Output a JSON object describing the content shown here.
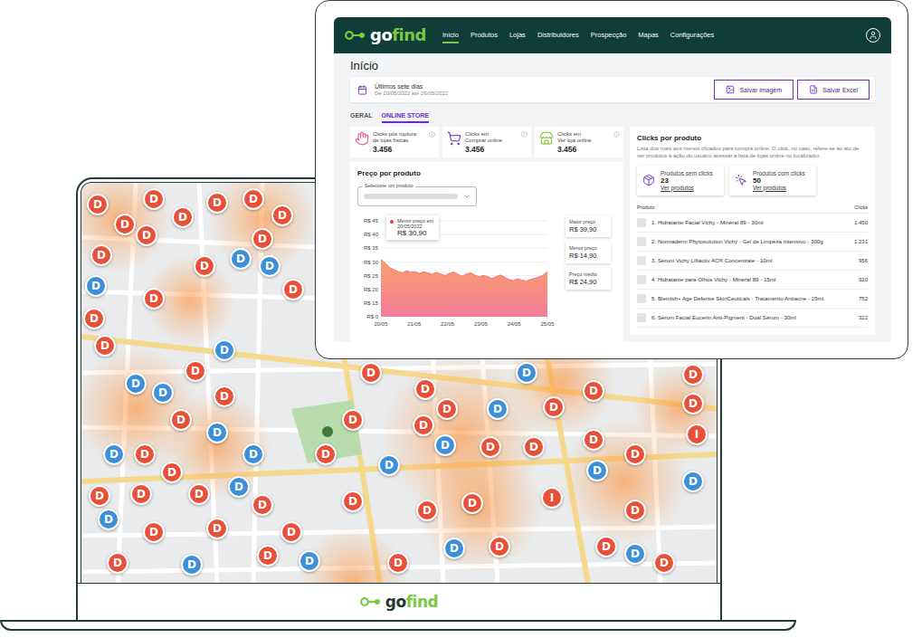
{
  "dashboard": {
    "logo": {
      "prefix": "go",
      "suffix": "find"
    },
    "nav": [
      {
        "label": "Início",
        "selected": true
      },
      {
        "label": "Produtos",
        "selected": false
      },
      {
        "label": "Lojas",
        "selected": false
      },
      {
        "label": "Distribuidores",
        "selected": false
      },
      {
        "label": "Prospecção",
        "selected": false
      },
      {
        "label": "Mapas",
        "selected": false
      },
      {
        "label": "Configurações",
        "selected": false
      }
    ],
    "page_title": "Início",
    "date_range": {
      "title": "Últimos sete dias",
      "subtitle": "De 20/05/2022 até 26/05/2022"
    },
    "actions": [
      "Salvar imagem",
      "Salvar Excel"
    ],
    "tabs": [
      {
        "label": "GERAL",
        "selected": false
      },
      {
        "label": "ONLINE STORE",
        "selected": true
      }
    ],
    "stats": [
      {
        "label_lines": [
          "Clicks pós ruptura",
          "de lojas físicas"
        ],
        "value": "3.456",
        "color": "#e8507a"
      },
      {
        "label_lines": [
          "Clicks em",
          "Comprar online"
        ],
        "value": "3.456",
        "color": "#6a2cc4"
      },
      {
        "label_lines": [
          "Clicks em",
          "Ver loja online"
        ],
        "value": "3.456",
        "color": "#7bbf2a"
      }
    ],
    "price_chart": {
      "title": "Preço por produto",
      "select_label": "Selecione um produto",
      "y_ticks": [
        "R$ 45",
        "R$ 40",
        "R$ 35",
        "R$ 30",
        "R$ 25",
        "R$ 20",
        "R$ 15",
        "R$ 0"
      ],
      "x_ticks": [
        "20/05",
        "21/05",
        "22/05",
        "23/05",
        "24/05",
        "25/05"
      ],
      "values": [
        30.9,
        29.5,
        28,
        27.2,
        26.5,
        26,
        26.8,
        26.2,
        26.5,
        25.8,
        26.4,
        26,
        25.5,
        26.2,
        25.6,
        25,
        25.8,
        26.3,
        25.5,
        24.8,
        25.6,
        26,
        25.2,
        24.5,
        25.1,
        24.6,
        24,
        24.6,
        25.2,
        24.4,
        23.6,
        23.2,
        23.8,
        23.4,
        23,
        23.6,
        24,
        24.5,
        25.2,
        26.5
      ],
      "tooltip": {
        "title": "Menor preço em",
        "date": "20/05/2022",
        "value": "R$ 30,90"
      },
      "summary": [
        {
          "label": "Maior preço",
          "value": "R$ 39,90"
        },
        {
          "label": "Menor preço",
          "value": "R$ 14,90"
        },
        {
          "label": "Preço médio",
          "value": "R$ 24,90"
        }
      ]
    },
    "clicks": {
      "title": "Clicks por produto",
      "description": "Lista dos mais aos menos clicados para compra online. O click, no caso, refere-se ao ato de ver produtos à ação do usuário acessar a lista de lojas online no localizador.",
      "cards": [
        {
          "label": "Produtos sem clicks",
          "value": "23",
          "link": "Ver produtos"
        },
        {
          "label": "Produtos com clicks",
          "value": "50",
          "link": "Ver produtos"
        }
      ],
      "columns": [
        "Produto",
        "Clicks"
      ],
      "rows": [
        {
          "product": "1. Hidratante Facial Vichy - Minéral 89 - 30ml",
          "clicks": "1.450"
        },
        {
          "product": "2. Normaderm Phytosolution Vichy - Gel de Limpeza Intensivo - 300g",
          "clicks": "1.231"
        },
        {
          "product": "3. Sérum Vichy Liftactiv AOX Concentrate - 10ml",
          "clicks": "956"
        },
        {
          "product": "4. Hidratante para Olhos Vichy - Mineral 89 - 15ml",
          "clicks": "920"
        },
        {
          "product": "5. Blemish+ Age Defense SkinCeuticals - Tratamento Antiacne - 15ml",
          "clicks": "752"
        },
        {
          "product": "6. Sérum Facial Eucerin Anti-Pigment - Dual Sérum - 30ml",
          "clicks": "322"
        }
      ]
    }
  },
  "laptop": {
    "logo": {
      "prefix": "go",
      "suffix": "find"
    },
    "pins": [
      {
        "label": "D",
        "color": "#e8503a"
      },
      {
        "label": "D",
        "color": "#e8503a"
      },
      {
        "label": "D",
        "color": "#e8503a"
      },
      {
        "label": "D",
        "color": "#e8503a"
      },
      {
        "label": "D",
        "color": "#e8503a"
      },
      {
        "label": "D",
        "color": "#e8503a"
      },
      {
        "label": "D",
        "color": "#e8503a"
      },
      {
        "label": "D",
        "color": "#e8503a"
      },
      {
        "label": "D",
        "color": "#e8503a"
      },
      {
        "label": "D",
        "color": "#3d8fd8"
      },
      {
        "label": "D",
        "color": "#3d8fd8"
      },
      {
        "label": "D",
        "color": "#e8503a"
      },
      {
        "label": "D",
        "color": "#e8503a"
      },
      {
        "label": "D",
        "color": "#3d8fd8"
      },
      {
        "label": "D",
        "color": "#e8503a"
      },
      {
        "label": "D",
        "color": "#e8503a"
      },
      {
        "label": "D",
        "color": "#e8503a"
      },
      {
        "label": "D",
        "color": "#3d8fd8"
      },
      {
        "label": "D",
        "color": "#e8503a"
      },
      {
        "label": "D",
        "color": "#3d8fd8"
      },
      {
        "label": "D",
        "color": "#3d8fd8"
      },
      {
        "label": "D",
        "color": "#e8503a"
      },
      {
        "label": "D",
        "color": "#e8503a"
      },
      {
        "label": "D",
        "color": "#e8503a"
      },
      {
        "label": "D",
        "color": "#3d8fd8"
      },
      {
        "label": "D",
        "color": "#3d8fd8"
      },
      {
        "label": "D",
        "color": "#3d8fd8"
      },
      {
        "label": "D",
        "color": "#e8503a"
      },
      {
        "label": "D",
        "color": "#e8503a"
      },
      {
        "label": "D",
        "color": "#3d8fd8"
      },
      {
        "label": "D",
        "color": "#e8503a"
      },
      {
        "label": "D",
        "color": "#e8503a"
      },
      {
        "label": "D",
        "color": "#e8503a"
      },
      {
        "label": "D",
        "color": "#3d8fd8"
      },
      {
        "label": "D",
        "color": "#e8503a"
      },
      {
        "label": "D",
        "color": "#e8503a"
      },
      {
        "label": "D",
        "color": "#e8503a"
      },
      {
        "label": "D",
        "color": "#e8503a"
      },
      {
        "label": "D",
        "color": "#e8503a"
      },
      {
        "label": "D",
        "color": "#e8503a"
      },
      {
        "label": "D",
        "color": "#e8503a"
      },
      {
        "label": "D",
        "color": "#3d8fd8"
      },
      {
        "label": "D",
        "color": "#e8503a"
      },
      {
        "label": "D",
        "color": "#e8503a"
      },
      {
        "label": "D",
        "color": "#e8503a"
      },
      {
        "label": "D",
        "color": "#e8503a"
      },
      {
        "label": "D",
        "color": "#3d8fd8"
      },
      {
        "label": "D",
        "color": "#e8503a"
      },
      {
        "label": "D",
        "color": "#3d8fd8"
      },
      {
        "label": "D",
        "color": "#e8503a"
      },
      {
        "label": "D",
        "color": "#3d8fd8"
      },
      {
        "label": "D",
        "color": "#e8503a"
      },
      {
        "label": "D",
        "color": "#e8503a"
      },
      {
        "label": "D",
        "color": "#e8503a"
      },
      {
        "label": "I",
        "color": "#e8503a"
      },
      {
        "label": "D",
        "color": "#e8503a"
      },
      {
        "label": "D",
        "color": "#e8503a"
      },
      {
        "label": "D",
        "color": "#3d8fd8"
      },
      {
        "label": "D",
        "color": "#e8503a"
      },
      {
        "label": "D",
        "color": "#e8503a"
      },
      {
        "label": "D",
        "color": "#e8503a"
      },
      {
        "label": "D",
        "color": "#e8503a"
      },
      {
        "label": "D",
        "color": "#3d8fd8"
      },
      {
        "label": "D",
        "color": "#e8503a"
      },
      {
        "label": "D",
        "color": "#e8503a"
      },
      {
        "label": "D",
        "color": "#3d8fd8"
      },
      {
        "label": "D",
        "color": "#e8503a"
      },
      {
        "label": "D",
        "color": "#e8503a"
      },
      {
        "label": "D",
        "color": "#3d8fd8"
      },
      {
        "label": "D",
        "color": "#e8503a"
      },
      {
        "label": "D",
        "color": "#3d8fd8"
      },
      {
        "label": "D",
        "color": "#3d8fd8"
      },
      {
        "label": "D",
        "color": "#e8503a"
      },
      {
        "label": "I",
        "color": "#e8503a"
      }
    ]
  }
}
